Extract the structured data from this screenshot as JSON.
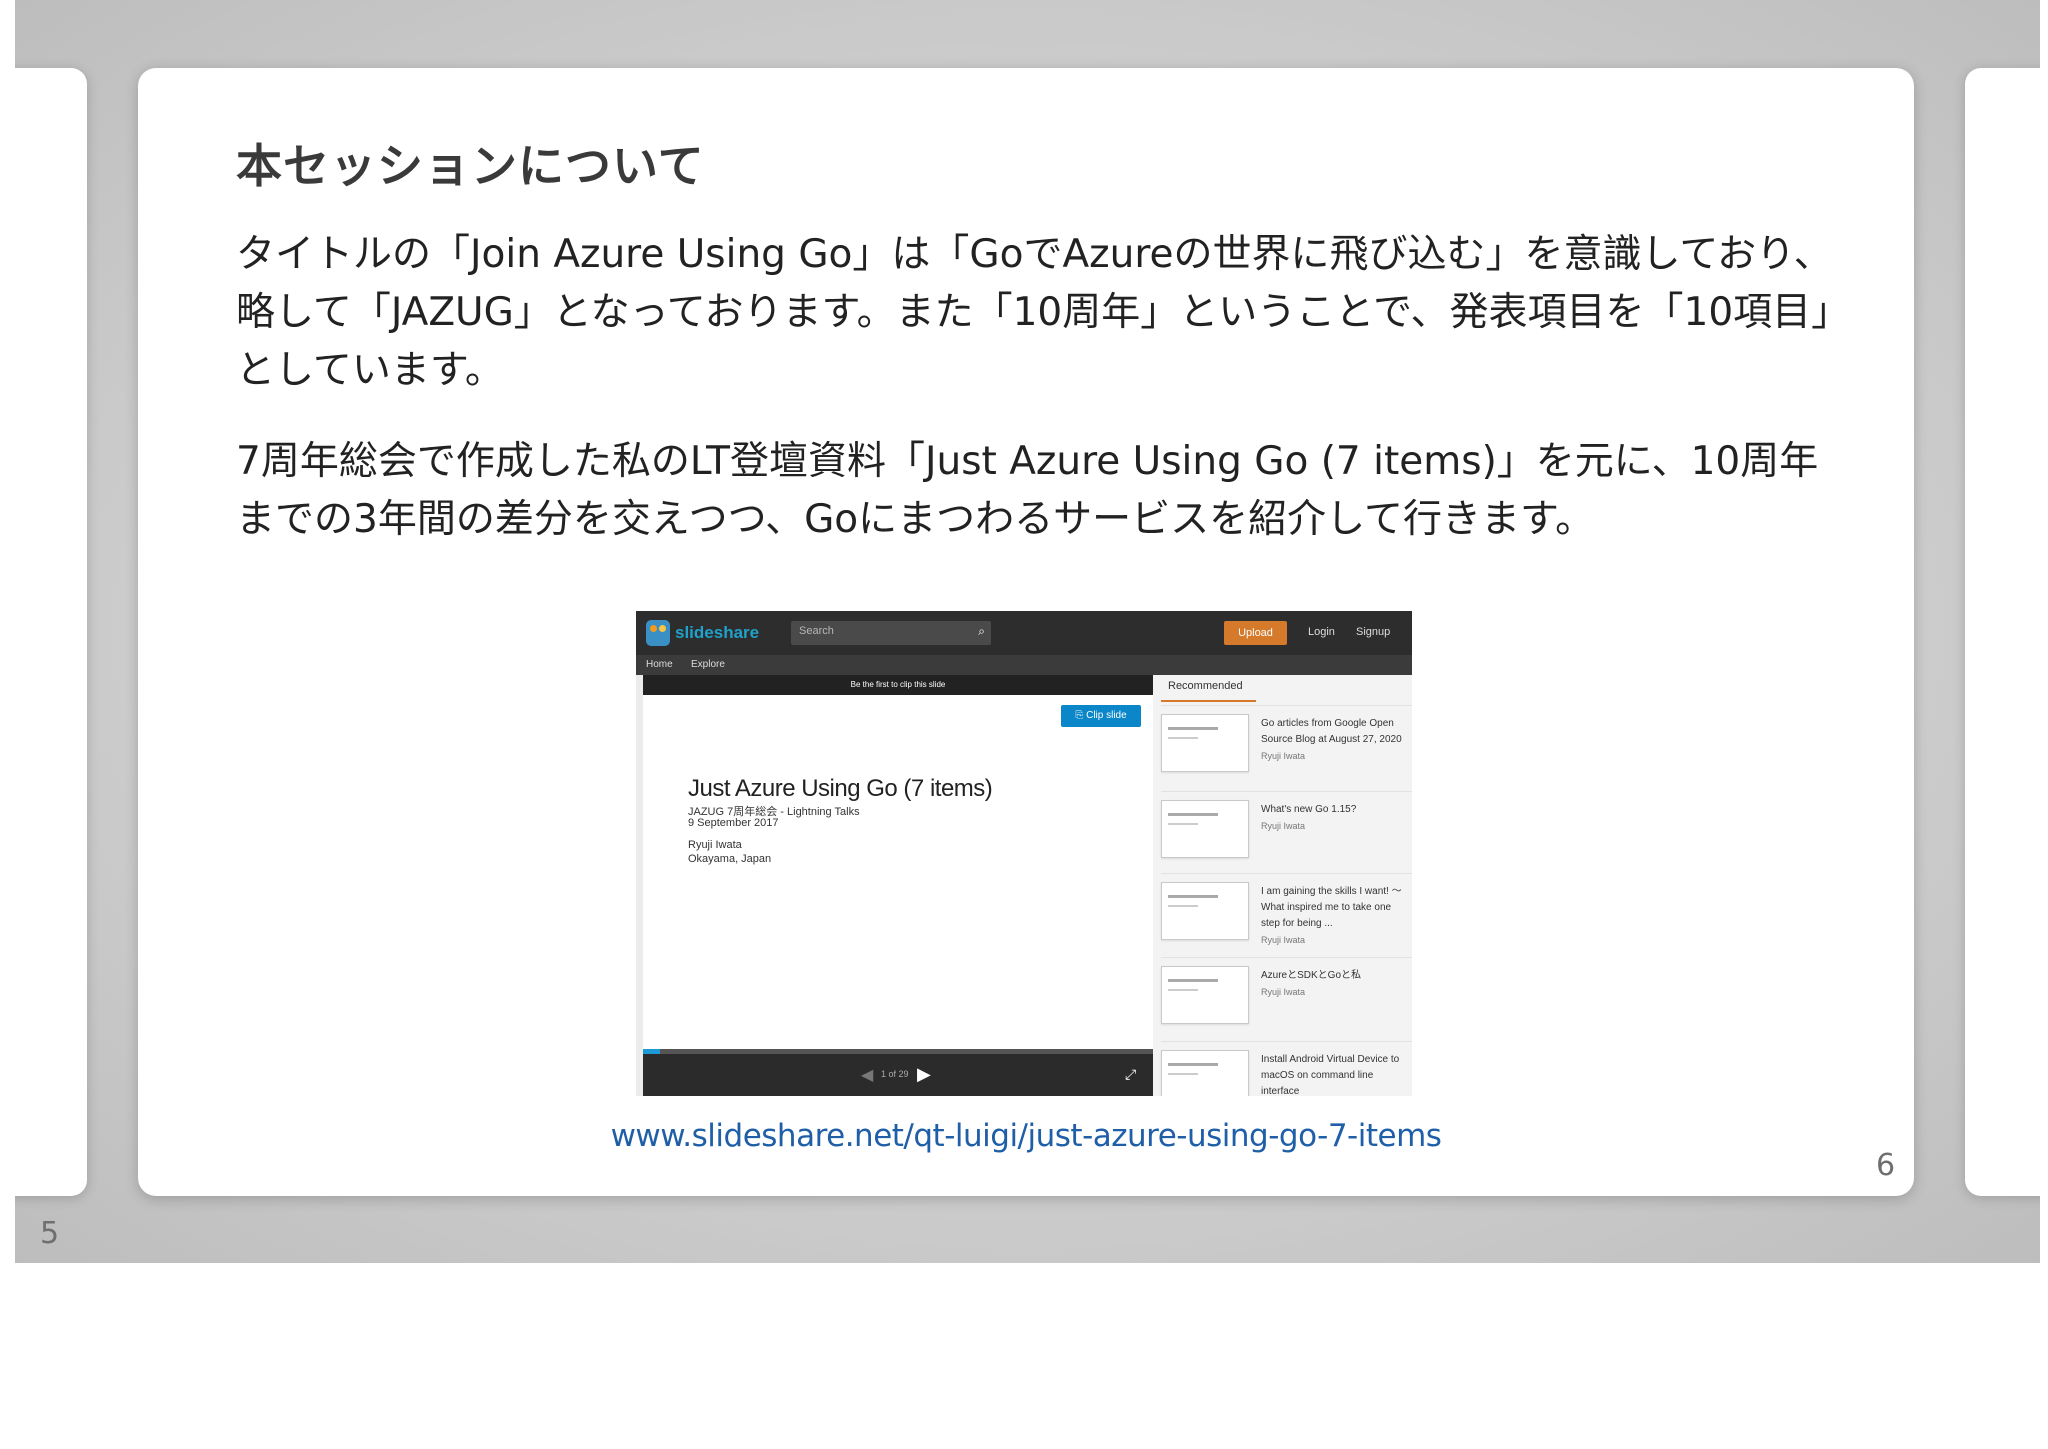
{
  "page_numbers": {
    "left": "5",
    "right": "6"
  },
  "slide": {
    "title": "本セッションについて",
    "paragraphs": [
      "タイトルの「Join Azure Using Go」は「GoでAzureの世界に飛び込む」を意識しており、略して「JAZUG」となっております。また「10周年」ということで、発表項目を「10項目」としています。",
      "7周年総会で作成した私のLT登壇資料「Just Azure Using Go (7 items)」を元に、10周年までの3年間の差分を交えつつ、Goにまつわるサービスを紹介して行きます。"
    ],
    "link_text": "www.slideshare.net/qt-luigi/just-azure-using-go-7-items",
    "link_color": "#1f5fa8"
  },
  "slideshare": {
    "logo_text": "slideshare",
    "search_placeholder": "Search",
    "upload_label": "Upload",
    "login_label": "Login",
    "signup_label": "Signup",
    "nav": {
      "home": "Home",
      "explore": "Explore"
    },
    "clip_banner": "Be the first to clip this slide",
    "clip_button": "Clip slide",
    "viewer_slide": {
      "title": "Just Azure Using Go (7 items)",
      "subtitle": "JAZUG 7周年総会 - Lightning Talks",
      "date": "9 September 2017",
      "author": "Ryuji Iwata",
      "place": "Okayama, Japan"
    },
    "pager": "1 of 29",
    "progress_fraction": 0.034,
    "recommended_label": "Recommended",
    "recommended": [
      {
        "title": "Go articles from Google Open Source Blog at August 27, 2020",
        "author": "Ryuji Iwata"
      },
      {
        "title": "What's new Go 1.15?",
        "author": "Ryuji Iwata"
      },
      {
        "title": "I am gaining the skills I want! 〜What inspired me to take one step for being ...",
        "author": "Ryuji Iwata"
      },
      {
        "title": "AzureとSDKとGoと私",
        "author": "Ryuji Iwata"
      },
      {
        "title": "Install Android Virtual Device to macOS on command line interface",
        "author": ""
      }
    ],
    "accent_color": "#d47a2a",
    "clip_color": "#0a86c9"
  },
  "icons": {
    "search": "search-icon",
    "prev": "triangle-left-icon",
    "next": "triangle-right-icon",
    "fullscreen": "expand-icon"
  }
}
